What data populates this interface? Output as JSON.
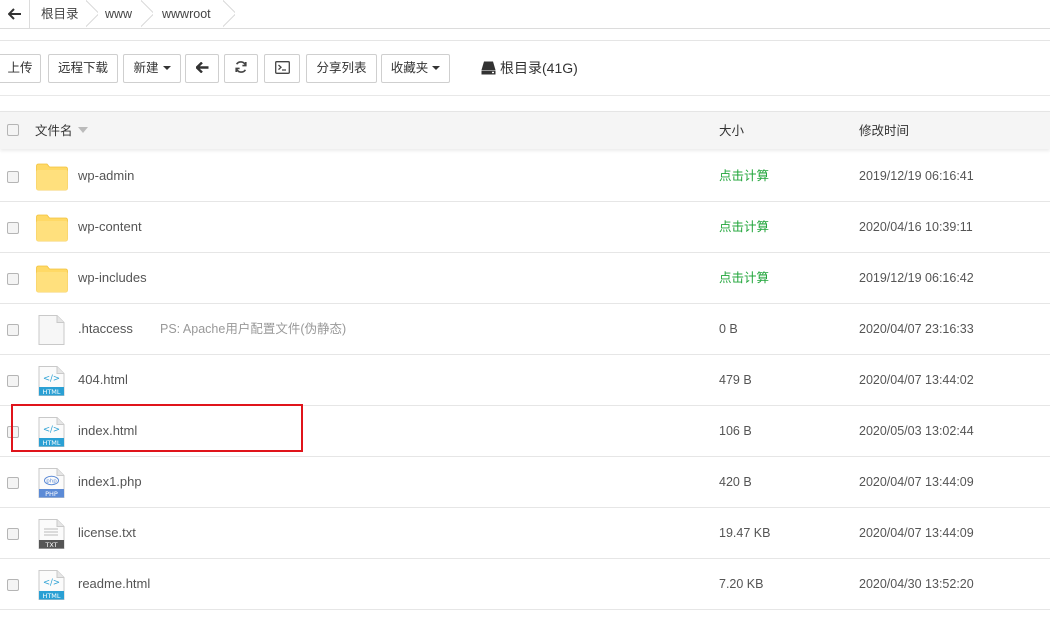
{
  "breadcrumb": {
    "items": [
      "根目录",
      "www",
      "wwwroot"
    ]
  },
  "toolbar": {
    "upload": "上传",
    "remote_download": "远程下载",
    "new": "新建",
    "share_list": "分享列表",
    "favorites": "收藏夹",
    "disk_label": "根目录(41G)"
  },
  "table": {
    "headers": {
      "name": "文件名",
      "size": "大小",
      "modified": "修改时间"
    },
    "rows": [
      {
        "name": "wp-admin",
        "type": "folder",
        "size": "点击计算",
        "modified": "2019/12/19 06:16:41",
        "note": ""
      },
      {
        "name": "wp-content",
        "type": "folder",
        "size": "点击计算",
        "modified": "2020/04/16 10:39:11",
        "note": ""
      },
      {
        "name": "wp-includes",
        "type": "folder",
        "size": "点击计算",
        "modified": "2019/12/19 06:16:42",
        "note": ""
      },
      {
        "name": ".htaccess",
        "type": "file",
        "size": "0 B",
        "modified": "2020/04/07 23:16:33",
        "note": "PS: Apache用户配置文件(伪静态)"
      },
      {
        "name": "404.html",
        "type": "html",
        "size": "479 B",
        "modified": "2020/04/07 13:44:02",
        "note": ""
      },
      {
        "name": "index.html",
        "type": "html",
        "size": "106 B",
        "modified": "2020/05/03 13:02:44",
        "note": ""
      },
      {
        "name": "index1.php",
        "type": "php",
        "size": "420 B",
        "modified": "2020/04/07 13:44:09",
        "note": ""
      },
      {
        "name": "license.txt",
        "type": "txt",
        "size": "19.47 KB",
        "modified": "2020/04/07 13:44:09",
        "note": ""
      },
      {
        "name": "readme.html",
        "type": "html",
        "size": "7.20 KB",
        "modified": "2020/04/30 13:52:20",
        "note": ""
      }
    ]
  },
  "icons": {
    "html_badge": "HTML",
    "php_badge": "PHP",
    "txt_badge": "TXT",
    "html_glyph": "</>",
    "php_glyph": "php"
  },
  "colors": {
    "calc_link": "#20a53a",
    "highlight_box": "#e0141b",
    "folder": "#ffd966",
    "html_badge": "#2aa0d4",
    "php_badge": "#5b8ad6",
    "txt_badge": "#555555"
  }
}
